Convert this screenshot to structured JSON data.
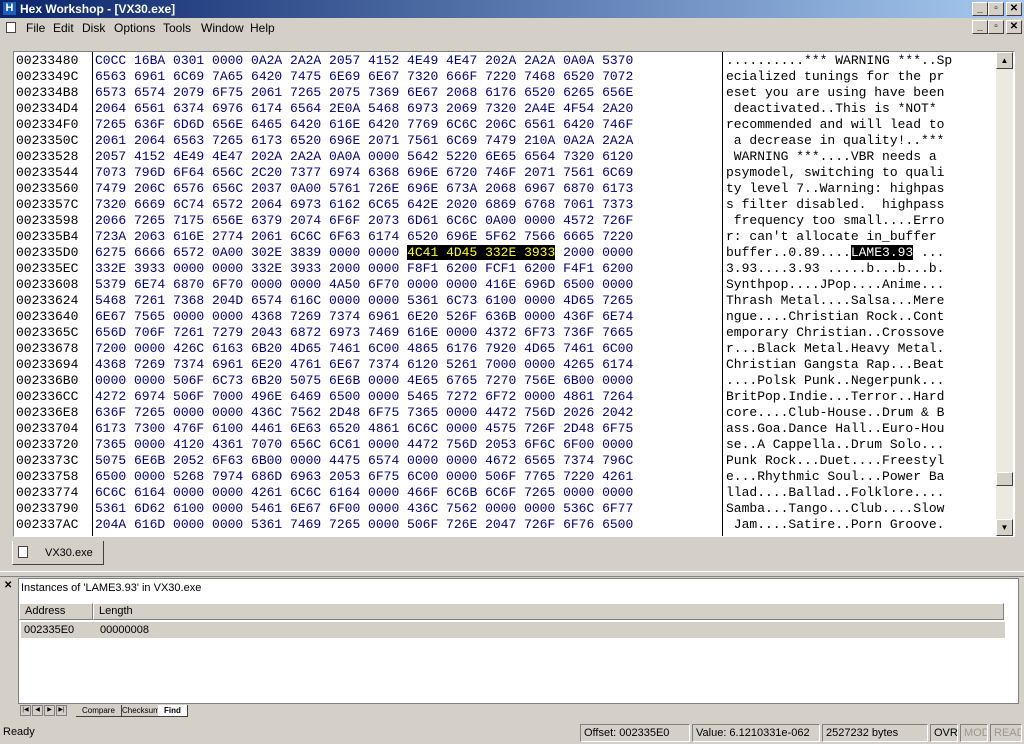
{
  "window": {
    "title": "Hex Workshop - [VX30.exe]",
    "app_icon": "H"
  },
  "menu": [
    "File",
    "Edit",
    "Disk",
    "Options",
    "Tools",
    "Window",
    "Help"
  ],
  "hex": {
    "addresses": [
      "00233480",
      "0023349C",
      "002334B8",
      "002334D4",
      "002334F0",
      "0023350C",
      "00233528",
      "00233544",
      "00233560",
      "0023357C",
      "00233598",
      "002335B4",
      "002335D0",
      "002335EC",
      "00233608",
      "00233624",
      "00233640",
      "0023365C",
      "00233678",
      "00233694",
      "002336B0",
      "002336CC",
      "002336E8",
      "00233704",
      "00233720",
      "0023373C",
      "00233758",
      "00233774",
      "00233790",
      "002337AC"
    ],
    "rows": [
      "C0CC 16BA 0301 0000 0A2A 2A2A 2057 4152 4E49 4E47 202A 2A2A 0A0A 5370",
      "6563 6961 6C69 7A65 6420 7475 6E69 6E67 7320 666F 7220 7468 6520 7072",
      "6573 6574 2079 6F75 2061 7265 2075 7369 6E67 2068 6176 6520 6265 656E",
      "2064 6561 6374 6976 6174 6564 2E0A 5468 6973 2069 7320 2A4E 4F54 2A20",
      "7265 636F 6D6D 656E 6465 6420 616E 6420 7769 6C6C 206C 6561 6420 746F",
      "2061 2064 6563 7265 6173 6520 696E 2071 7561 6C69 7479 210A 0A2A 2A2A",
      "2057 4152 4E49 4E47 202A 2A2A 0A0A 0000 5642 5220 6E65 6564 7320 6120",
      "7073 796D 6F64 656C 2C20 7377 6974 6368 696E 6720 746F 2071 7561 6C69",
      "7479 206C 6576 656C 2037 0A00 5761 726E 696E 673A 2068 6967 6870 6173",
      "7320 6669 6C74 6572 2064 6973 6162 6C65 642E 2020 6869 6768 7061 7373",
      "2066 7265 7175 656E 6379 2074 6F6F 2073 6D61 6C6C 0A00 0000 4572 726F",
      "723A 2063 616E 2774 2061 6C6C 6F63 6174 6520 696E 5F62 7566 6665 7220",
      "6275 6666 6572 0A00 302E 3839 0000 0000 4C41 4D45 332E 3933 2000 0000",
      "332E 3933 0000 0000 332E 3933 2000 0000 F8F1 6200 FCF1 6200 F4F1 6200",
      "5379 6E74 6870 6F70 0000 0000 4A50 6F70 0000 0000 416E 696D 6500 0000",
      "5468 7261 7368 204D 6574 616C 0000 0000 5361 6C73 6100 0000 4D65 7265",
      "6E67 7565 0000 0000 4368 7269 7374 6961 6E20 526F 636B 0000 436F 6E74",
      "656D 706F 7261 7279 2043 6872 6973 7469 616E 0000 4372 6F73 736F 7665",
      "7200 0000 426C 6163 6B20 4D65 7461 6C00 4865 6176 7920 4D65 7461 6C00",
      "4368 7269 7374 6961 6E20 4761 6E67 7374 6120 5261 7000 0000 4265 6174",
      "0000 0000 506F 6C73 6B20 5075 6E6B 0000 4E65 6765 7270 756E 6B00 0000",
      "4272 6974 506F 7000 496E 6469 6500 0000 5465 7272 6F72 0000 4861 7264",
      "636F 7265 0000 0000 436C 7562 2D48 6F75 7365 0000 4472 756D 2026 2042",
      "6173 7300 476F 6100 4461 6E63 6520 4861 6C6C 0000 4575 726F 2D48 6F75",
      "7365 0000 4120 4361 7070 656C 6C61 0000 4472 756D 2053 6F6C 6F00 0000",
      "5075 6E6B 2052 6F63 6B00 0000 4475 6574 0000 0000 4672 6565 7374 796C",
      "6500 0000 5268 7974 686D 6963 2053 6F75 6C00 0000 506F 7765 7220 4261",
      "6C6C 6164 0000 0000 4261 6C6C 6164 0000 466F 6C6B 6C6F 7265 0000 0000",
      "5361 6D62 6100 0000 5461 6E67 6F00 0000 436C 7562 0000 0000 536C 6F77",
      "204A 616D 0000 0000 5361 7469 7265 0000 506F 726E 2047 726F 6F76 6500"
    ],
    "highlight_row": 12,
    "highlight_hex": {
      "before": "6275 6666 6572 0A00 302E 3839 0000 0000 ",
      "match": "4C41 4D45 332E 3933",
      "after": " 2000 0000"
    },
    "ascii": [
      "..........*** WARNING ***..Sp",
      "ecialized tunings for the pr",
      "eset you are using have been",
      " deactivated..This is *NOT* ",
      "recommended and will lead to",
      " a decrease in quality!..***",
      " WARNING ***....VBR needs a ",
      "psymodel, switching to quali",
      "ty level 7..Warning: highpas",
      "s filter disabled.  highpass",
      " frequency too small....Erro",
      "r: can't allocate in_buffer ",
      "buffer..0.89....LAME3.93 ...",
      "3.93....3.93 .....b...b...b.",
      "Synthpop....JPop....Anime...",
      "Thrash Metal....Salsa...Mere",
      "ngue....Christian Rock..Cont",
      "emporary Christian..Crossove",
      "r...Black Metal.Heavy Metal.",
      "Christian Gangsta Rap...Beat",
      "....Polsk Punk..Negerpunk...",
      "BritPop.Indie...Terror..Hard",
      "core....Club-House..Drum & B",
      "ass.Goa.Dance Hall..Euro-Hou",
      "se..A Cappella..Drum Solo...",
      "Punk Rock...Duet....Freestyl",
      "e...Rhythmic Soul...Power Ba",
      "llad....Ballad..Folklore....",
      "Samba...Tango...Club....Slow",
      " Jam....Satire..Porn Groove."
    ],
    "highlight_ascii": {
      "before": "buffer..0.89....",
      "match": "LAME3.93",
      "after": " ..."
    }
  },
  "doc_tab": {
    "label": "VX30.exe"
  },
  "results": {
    "caption": "Instances of 'LAME3.93' in VX30.exe",
    "columns": [
      "Address",
      "Length"
    ],
    "rows": [
      {
        "address": "002335E0",
        "length": "00000008"
      }
    ]
  },
  "bottom_tabs": [
    "Compare",
    "Checksum",
    "Find"
  ],
  "status": {
    "ready": "Ready",
    "offset": "Offset: 002335E0",
    "value": "Value: 6.1210331e-062",
    "size": "2527232 bytes",
    "ovr": "OVR",
    "mod": "MOD",
    "read": "READ"
  }
}
